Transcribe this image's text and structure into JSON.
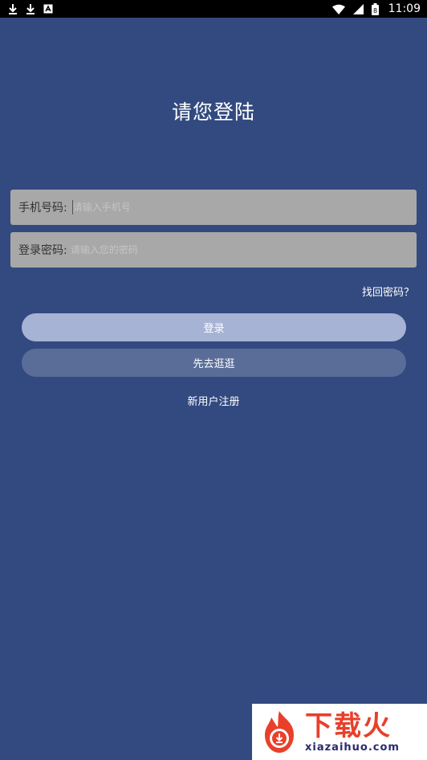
{
  "status_bar": {
    "time": "11:09",
    "battery_level": "8"
  },
  "page": {
    "title": "请您登陆"
  },
  "form": {
    "phone": {
      "label": "手机号码:",
      "placeholder": "请输入手机号",
      "value": ""
    },
    "password": {
      "label": "登录密码:",
      "placeholder": "请输入您的密码",
      "value": ""
    },
    "forgot_label": "找回密码？",
    "login_label": "登录",
    "browse_label": "先去逛逛",
    "register_label": "新用户注册"
  },
  "watermark": {
    "brand": "下载火",
    "domain": "xiazaihuo.com"
  },
  "colors": {
    "background": "#324a80",
    "input_bg": "#a8a8a8",
    "login_button": "#a7b3d4",
    "browse_button": "#5a6d99",
    "watermark_red": "#e8402a"
  }
}
